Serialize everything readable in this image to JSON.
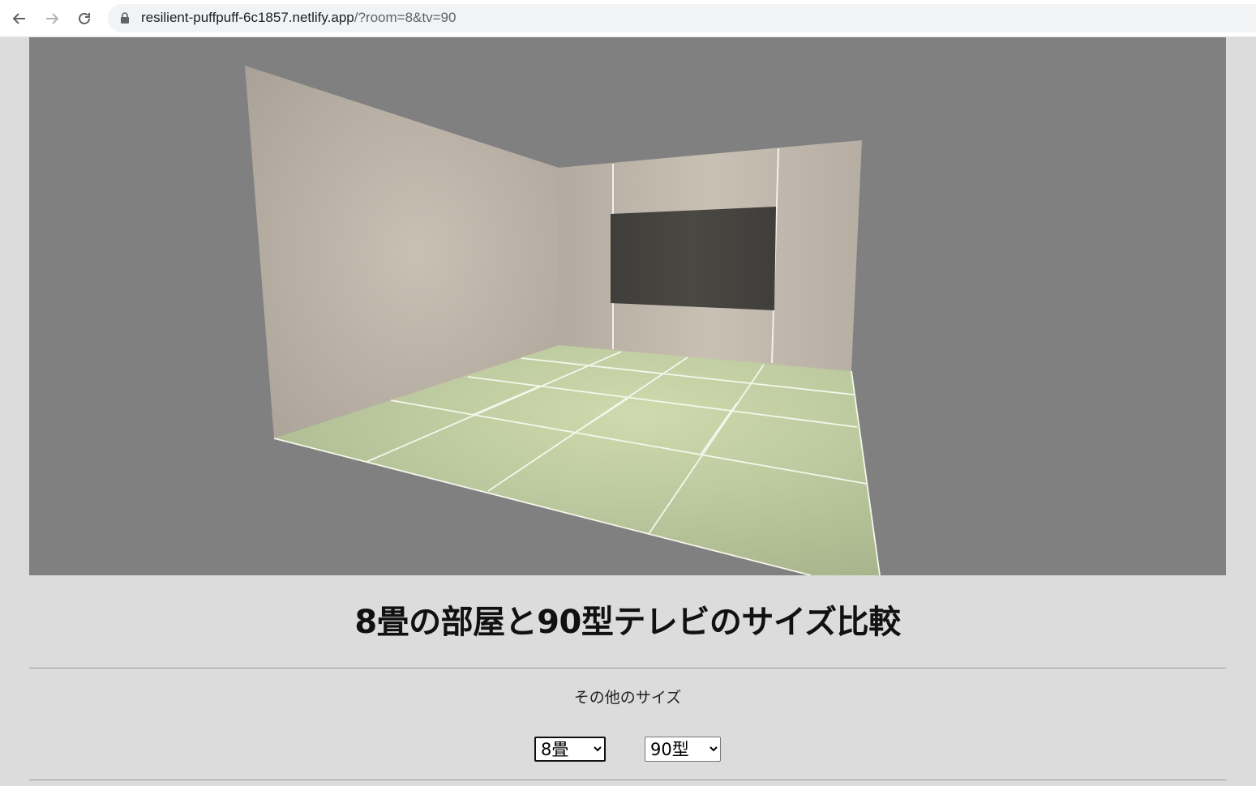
{
  "browser": {
    "url_host": "resilient-puffpuff-6c1857.netlify.app",
    "url_path": "/?room=8&tv=90"
  },
  "page": {
    "title": "8畳の部屋と90型テレビのサイズ比較",
    "other_sizes_label": "その他のサイズ",
    "room_select": {
      "selected": "8畳",
      "options": [
        "8畳"
      ]
    },
    "tv_select": {
      "selected": "90型",
      "options": [
        "90型"
      ]
    }
  },
  "colors": {
    "scene_background": "#808080",
    "wall": "#c8bfb3",
    "tatami": "#c7d3a8",
    "tv_screen": "#444440",
    "page_background": "#dcdcdc"
  }
}
